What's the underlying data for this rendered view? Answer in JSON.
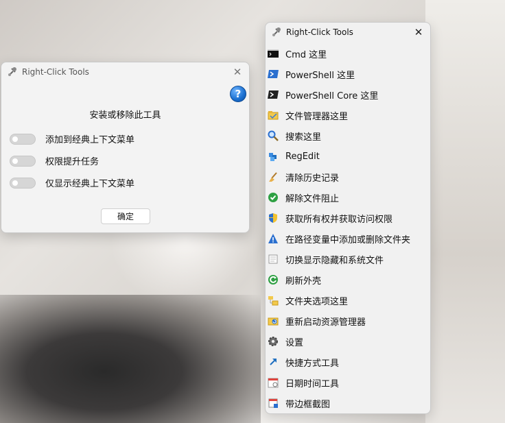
{
  "settings_dialog": {
    "title": "Right-Click Tools",
    "help_glyph": "?",
    "heading": "安装或移除此工具",
    "toggles": [
      {
        "label": "添加到经典上下文菜单",
        "on": false
      },
      {
        "label": "权限提升任务",
        "on": false
      },
      {
        "label": "仅显示经典上下文菜单",
        "on": false
      }
    ],
    "ok_label": "确定",
    "close_glyph": "✕"
  },
  "menu_window": {
    "title": "Right-Click Tools",
    "close_glyph": "✕",
    "items": [
      {
        "label": "Cmd 这里",
        "icon": "cmd-icon"
      },
      {
        "label": "PowerShell 这里",
        "icon": "powershell-icon"
      },
      {
        "label": "PowerShell Core 这里",
        "icon": "powershell-core-icon"
      },
      {
        "label": "文件管理器这里",
        "icon": "file-explorer-icon"
      },
      {
        "label": "搜索这里",
        "icon": "search-icon"
      },
      {
        "label": "RegEdit",
        "icon": "regedit-icon"
      },
      {
        "label": "清除历史记录",
        "icon": "broom-icon"
      },
      {
        "label": "解除文件阻止",
        "icon": "check-icon"
      },
      {
        "label": "获取所有权并获取访问权限",
        "icon": "shield-icon"
      },
      {
        "label": "在路径变量中添加或删除文件夹",
        "icon": "warning-icon"
      },
      {
        "label": "切换显示隐藏和系统文件",
        "icon": "hidden-files-icon"
      },
      {
        "label": "刷新外壳",
        "icon": "refresh-icon"
      },
      {
        "label": "文件夹选项这里",
        "icon": "folder-options-icon"
      },
      {
        "label": "重新启动资源管理器",
        "icon": "restart-explorer-icon"
      },
      {
        "label": "设置",
        "icon": "gear-icon"
      },
      {
        "label": "快捷方式工具",
        "icon": "shortcut-icon"
      },
      {
        "label": "日期时间工具",
        "icon": "calendar-icon"
      },
      {
        "label": "带边框截图",
        "icon": "screenshot-icon"
      }
    ]
  }
}
